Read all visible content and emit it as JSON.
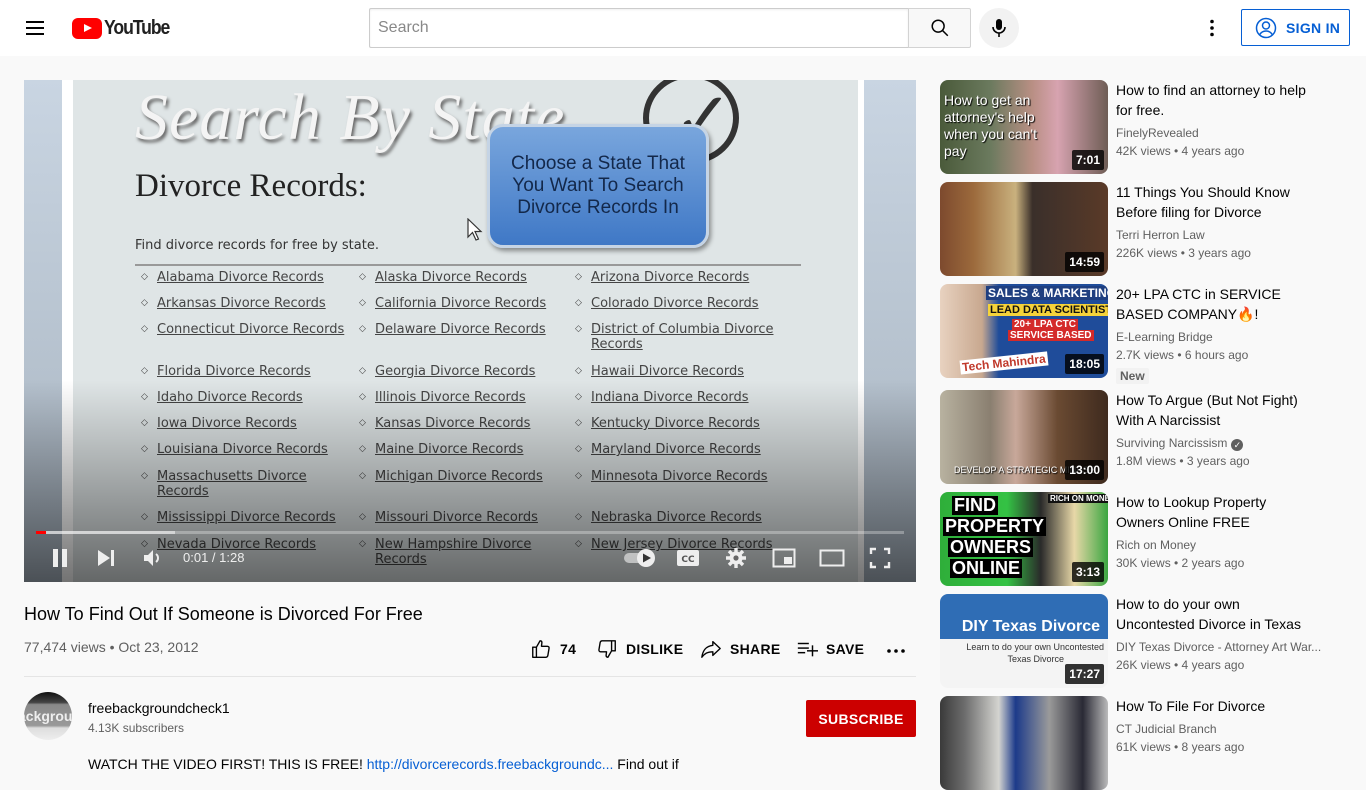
{
  "header": {
    "logo_text": "YouTube",
    "search_placeholder": "Search",
    "sign_in_label": "SIGN IN",
    "icons": [
      "hamburger-menu-icon",
      "youtube-logo-icon",
      "search-icon",
      "microphone-icon",
      "more-vert-icon",
      "account-circle-icon"
    ]
  },
  "player": {
    "frame": {
      "heading": "Search By State",
      "subheading": "Divorce Records:",
      "intro": "Find divorce records for free by state.",
      "callout": "Choose a State That You Want To Search Divorce Records In",
      "states": [
        [
          "Alabama Divorce Records",
          "Alaska Divorce Records",
          "Arizona Divorce Records"
        ],
        [
          "Arkansas Divorce Records",
          "California Divorce Records",
          "Colorado Divorce Records"
        ],
        [
          "Connecticut Divorce Records",
          "Delaware Divorce Records",
          "District of Columbia Divorce Records"
        ],
        [
          "Florida Divorce Records",
          "Georgia Divorce Records",
          "Hawaii Divorce Records"
        ],
        [
          "Idaho Divorce Records",
          "Illinois Divorce Records",
          "Indiana Divorce Records"
        ],
        [
          "Iowa Divorce Records",
          "Kansas Divorce Records",
          "Kentucky Divorce Records"
        ],
        [
          "Louisiana Divorce Records",
          "Maine Divorce Records",
          "Maryland Divorce Records"
        ],
        [
          "Massachusetts Divorce Records",
          "Michigan Divorce Records",
          "Minnesota Divorce Records"
        ],
        [
          "Mississippi Divorce Records",
          "Missouri Divorce Records",
          "Nebraska Divorce Records"
        ],
        [
          "Nevada Divorce Records",
          "New Hampshire Divorce Records",
          "New Jersey Divorce Records"
        ]
      ]
    },
    "current_time": "0:01",
    "duration": "1:28",
    "time_display": "0:01 / 1:28",
    "progress_played_fraction": 0.011,
    "progress_loaded_fraction": 0.16,
    "autoplay_on": true,
    "controls": [
      "pause-icon",
      "next-icon",
      "volume-icon",
      "autoplay-toggle",
      "captions-icon",
      "settings-icon",
      "miniplayer-icon",
      "theater-mode-icon",
      "fullscreen-icon"
    ],
    "accent_color": "#ff0000"
  },
  "video": {
    "title": "How To Find Out If Someone is Divorced For Free",
    "meta": "77,474 views • Oct 23, 2012",
    "views": "77,474 views",
    "date": "Oct 23, 2012",
    "likes": "74",
    "dislike_label": "DISLIKE",
    "share_label": "SHARE",
    "save_label": "SAVE"
  },
  "channel": {
    "name": "freebackgroundcheck1",
    "subscribers": "4.13K subscribers",
    "avatar_text": "ackgrou",
    "subscribe_label": "SUBSCRIBE",
    "subscribe_color": "#cc0000"
  },
  "description": {
    "prefix": "WATCH THE VIDEO FIRST! THIS IS FREE! ",
    "link": "http://divorcerecords.freebackgroundc...",
    "suffix": " Find out if"
  },
  "recommendations": [
    {
      "title": "How to find an attorney to help for free.",
      "channel": "FinelyRevealed",
      "stats": "42K views • 4 years ago",
      "duration": "7:01",
      "thumb_text": "How to get an attorney's help when you can't pay"
    },
    {
      "title": "11 Things You Should Know Before filing for Divorce",
      "channel": "Terri Herron Law",
      "stats": "226K views • 3 years ago",
      "duration": "14:59"
    },
    {
      "title": "20+ LPA CTC in SERVICE BASED COMPANY🔥! SALES...",
      "channel": "E-Learning Bridge",
      "stats": "2.7K views • 6 hours ago",
      "duration": "18:05",
      "badge": "New",
      "thumb_text": [
        "SALES & MARKETING",
        "LEAD DATA SCIENTIST",
        "20+ LPA CTC",
        "SERVICE BASED",
        "Tech Mahindra"
      ]
    },
    {
      "title": "How To Argue (But Not Fight) With A Narcissist",
      "channel": "Surviving Narcissism",
      "verified": true,
      "stats": "1.8M views • 3 years ago",
      "duration": "13:00",
      "thumb_text": "DEVELOP A STRATEGIC MINDSE"
    },
    {
      "title": "How to Lookup Property Owners Online FREE",
      "channel": "Rich on Money",
      "stats": "30K views • 2 years ago",
      "duration": "3:13",
      "thumb_text": [
        "FIND",
        "PROPERTY",
        "OWNERS",
        "ONLINE",
        "RICH ON MONEY"
      ]
    },
    {
      "title": "How to do your own Uncontested Divorce in Texas",
      "channel": "DIY Texas Divorce - Attorney Art War...",
      "stats": "26K views • 4 years ago",
      "duration": "17:27",
      "thumb_text": [
        "DIY Texas Divorce",
        "Learn to do your own Uncontested",
        "Texas Divorce"
      ]
    },
    {
      "title": "How To File For Divorce",
      "channel": "CT Judicial Branch",
      "stats": "61K views • 8 years ago"
    }
  ]
}
